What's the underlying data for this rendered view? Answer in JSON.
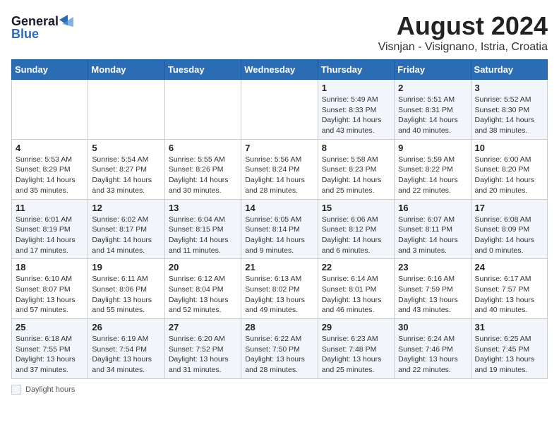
{
  "logo": {
    "line1": "General",
    "line2": "Blue"
  },
  "title": "August 2024",
  "subtitle": "Visnjan - Visignano, Istria, Croatia",
  "days_of_week": [
    "Sunday",
    "Monday",
    "Tuesday",
    "Wednesday",
    "Thursday",
    "Friday",
    "Saturday"
  ],
  "footer": {
    "label": "Daylight hours"
  },
  "weeks": [
    [
      {
        "day": "",
        "info": ""
      },
      {
        "day": "",
        "info": ""
      },
      {
        "day": "",
        "info": ""
      },
      {
        "day": "",
        "info": ""
      },
      {
        "day": "1",
        "info": "Sunrise: 5:49 AM\nSunset: 8:33 PM\nDaylight: 14 hours\nand 43 minutes."
      },
      {
        "day": "2",
        "info": "Sunrise: 5:51 AM\nSunset: 8:31 PM\nDaylight: 14 hours\nand 40 minutes."
      },
      {
        "day": "3",
        "info": "Sunrise: 5:52 AM\nSunset: 8:30 PM\nDaylight: 14 hours\nand 38 minutes."
      }
    ],
    [
      {
        "day": "4",
        "info": "Sunrise: 5:53 AM\nSunset: 8:29 PM\nDaylight: 14 hours\nand 35 minutes."
      },
      {
        "day": "5",
        "info": "Sunrise: 5:54 AM\nSunset: 8:27 PM\nDaylight: 14 hours\nand 33 minutes."
      },
      {
        "day": "6",
        "info": "Sunrise: 5:55 AM\nSunset: 8:26 PM\nDaylight: 14 hours\nand 30 minutes."
      },
      {
        "day": "7",
        "info": "Sunrise: 5:56 AM\nSunset: 8:24 PM\nDaylight: 14 hours\nand 28 minutes."
      },
      {
        "day": "8",
        "info": "Sunrise: 5:58 AM\nSunset: 8:23 PM\nDaylight: 14 hours\nand 25 minutes."
      },
      {
        "day": "9",
        "info": "Sunrise: 5:59 AM\nSunset: 8:22 PM\nDaylight: 14 hours\nand 22 minutes."
      },
      {
        "day": "10",
        "info": "Sunrise: 6:00 AM\nSunset: 8:20 PM\nDaylight: 14 hours\nand 20 minutes."
      }
    ],
    [
      {
        "day": "11",
        "info": "Sunrise: 6:01 AM\nSunset: 8:19 PM\nDaylight: 14 hours\nand 17 minutes."
      },
      {
        "day": "12",
        "info": "Sunrise: 6:02 AM\nSunset: 8:17 PM\nDaylight: 14 hours\nand 14 minutes."
      },
      {
        "day": "13",
        "info": "Sunrise: 6:04 AM\nSunset: 8:15 PM\nDaylight: 14 hours\nand 11 minutes."
      },
      {
        "day": "14",
        "info": "Sunrise: 6:05 AM\nSunset: 8:14 PM\nDaylight: 14 hours\nand 9 minutes."
      },
      {
        "day": "15",
        "info": "Sunrise: 6:06 AM\nSunset: 8:12 PM\nDaylight: 14 hours\nand 6 minutes."
      },
      {
        "day": "16",
        "info": "Sunrise: 6:07 AM\nSunset: 8:11 PM\nDaylight: 14 hours\nand 3 minutes."
      },
      {
        "day": "17",
        "info": "Sunrise: 6:08 AM\nSunset: 8:09 PM\nDaylight: 14 hours\nand 0 minutes."
      }
    ],
    [
      {
        "day": "18",
        "info": "Sunrise: 6:10 AM\nSunset: 8:07 PM\nDaylight: 13 hours\nand 57 minutes."
      },
      {
        "day": "19",
        "info": "Sunrise: 6:11 AM\nSunset: 8:06 PM\nDaylight: 13 hours\nand 55 minutes."
      },
      {
        "day": "20",
        "info": "Sunrise: 6:12 AM\nSunset: 8:04 PM\nDaylight: 13 hours\nand 52 minutes."
      },
      {
        "day": "21",
        "info": "Sunrise: 6:13 AM\nSunset: 8:02 PM\nDaylight: 13 hours\nand 49 minutes."
      },
      {
        "day": "22",
        "info": "Sunrise: 6:14 AM\nSunset: 8:01 PM\nDaylight: 13 hours\nand 46 minutes."
      },
      {
        "day": "23",
        "info": "Sunrise: 6:16 AM\nSunset: 7:59 PM\nDaylight: 13 hours\nand 43 minutes."
      },
      {
        "day": "24",
        "info": "Sunrise: 6:17 AM\nSunset: 7:57 PM\nDaylight: 13 hours\nand 40 minutes."
      }
    ],
    [
      {
        "day": "25",
        "info": "Sunrise: 6:18 AM\nSunset: 7:55 PM\nDaylight: 13 hours\nand 37 minutes."
      },
      {
        "day": "26",
        "info": "Sunrise: 6:19 AM\nSunset: 7:54 PM\nDaylight: 13 hours\nand 34 minutes."
      },
      {
        "day": "27",
        "info": "Sunrise: 6:20 AM\nSunset: 7:52 PM\nDaylight: 13 hours\nand 31 minutes."
      },
      {
        "day": "28",
        "info": "Sunrise: 6:22 AM\nSunset: 7:50 PM\nDaylight: 13 hours\nand 28 minutes."
      },
      {
        "day": "29",
        "info": "Sunrise: 6:23 AM\nSunset: 7:48 PM\nDaylight: 13 hours\nand 25 minutes."
      },
      {
        "day": "30",
        "info": "Sunrise: 6:24 AM\nSunset: 7:46 PM\nDaylight: 13 hours\nand 22 minutes."
      },
      {
        "day": "31",
        "info": "Sunrise: 6:25 AM\nSunset: 7:45 PM\nDaylight: 13 hours\nand 19 minutes."
      }
    ]
  ]
}
